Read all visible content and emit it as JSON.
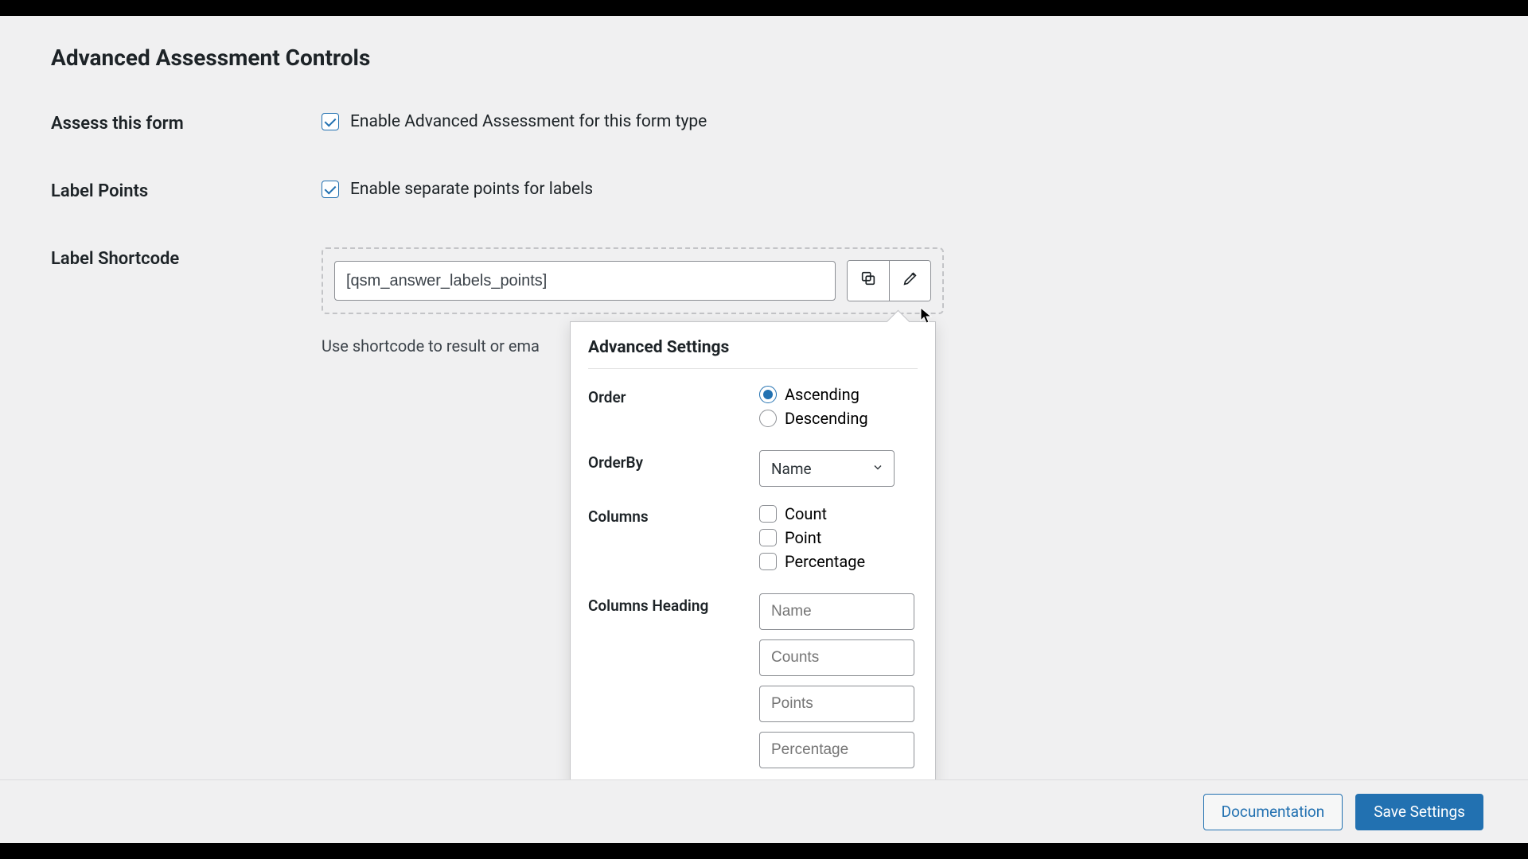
{
  "page": {
    "title": "Advanced Assessment Controls"
  },
  "assess": {
    "label": "Assess this form",
    "checkbox_label": "Enable Advanced Assessment for this form type",
    "checked": true
  },
  "label_points": {
    "label": "Label Points",
    "checkbox_label": "Enable separate points for labels",
    "checked": true
  },
  "shortcode": {
    "label": "Label Shortcode",
    "value": "[qsm_answer_labels_points]",
    "hint": "Use shortcode to result or ema"
  },
  "popover": {
    "title": "Advanced Settings",
    "order": {
      "label": "Order",
      "asc": "Ascending",
      "desc": "Descending",
      "selected": "asc"
    },
    "orderby": {
      "label": "OrderBy",
      "value": "Name"
    },
    "columns": {
      "label": "Columns",
      "count": "Count",
      "point": "Point",
      "percentage": "Percentage"
    },
    "headings": {
      "label": "Columns Heading",
      "ph_name": "Name",
      "ph_counts": "Counts",
      "ph_points": "Points",
      "ph_percentage": "Percentage"
    }
  },
  "footer": {
    "documentation": "Documentation",
    "save": "Save Settings"
  }
}
